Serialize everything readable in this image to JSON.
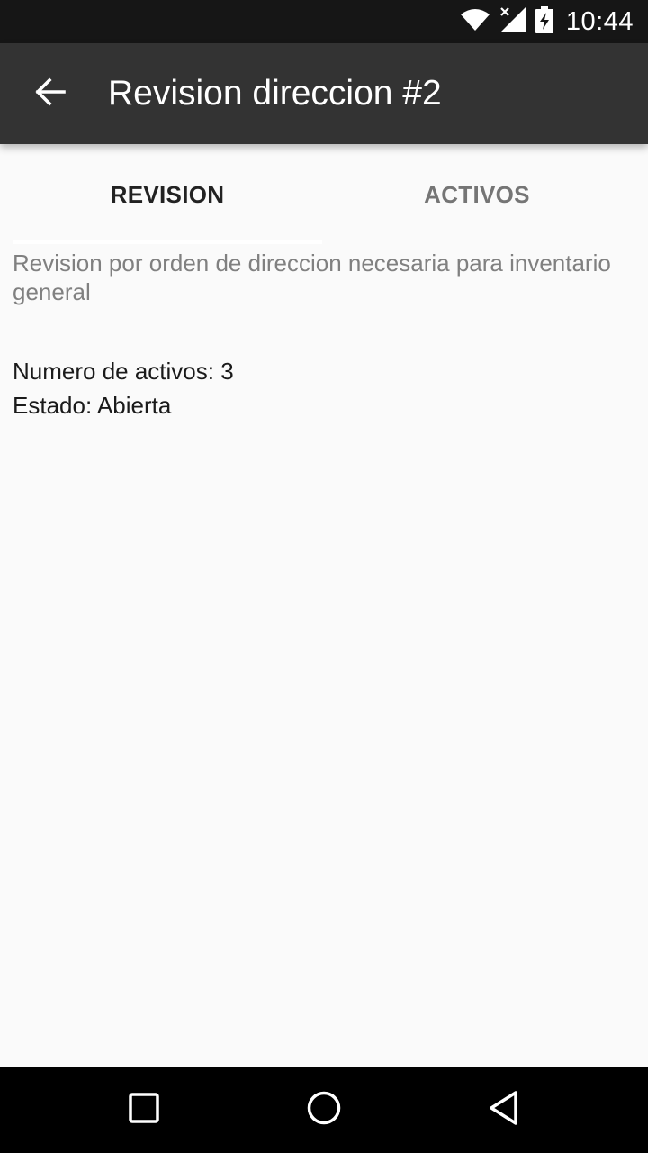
{
  "status_bar": {
    "time": "10:44",
    "icons": [
      "wifi-icon",
      "signal-icon",
      "battery-charging-icon"
    ]
  },
  "app_bar": {
    "back_icon": "arrow-back-icon",
    "title": "Revision direccion #2"
  },
  "tabs": [
    {
      "label": "REVISION",
      "selected": true
    },
    {
      "label": "ACTIVOS",
      "selected": false
    }
  ],
  "content": {
    "description": "Revision por orden de direccion necesaria para inventario general",
    "asset_count": "Numero de activos: 3",
    "state": "Estado: Abierta"
  },
  "nav_bar": {
    "icons": [
      "recents-icon",
      "home-icon",
      "back-triangle-icon"
    ]
  },
  "colors": {
    "status_bar": "#161616",
    "app_bar": "#333333",
    "background": "#fafafa",
    "nav_bar": "#000000"
  }
}
